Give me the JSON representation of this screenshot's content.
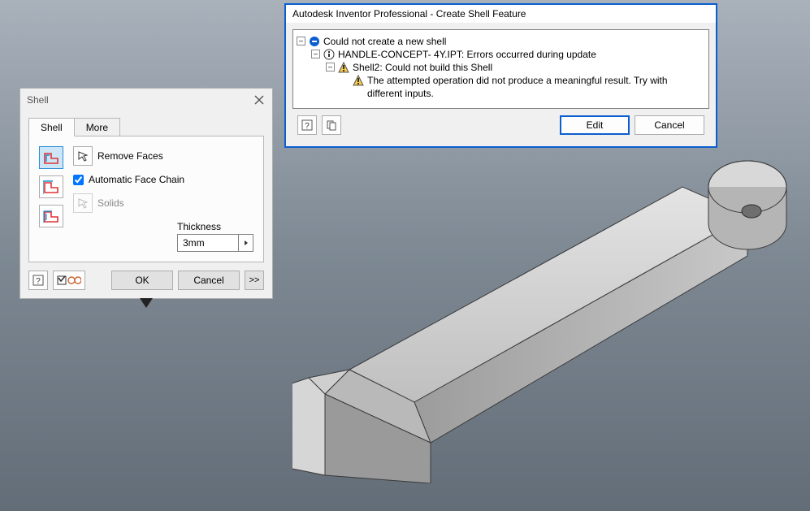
{
  "error_dialog": {
    "title": "Autodesk Inventor Professional - Create Shell Feature",
    "tree": {
      "root": "Could not create a new shell",
      "file": "HANDLE-CONCEPT- 4Y.IPT: Errors occurred during update",
      "feature": "Shell2: Could not build this Shell",
      "detail": "The attempted operation did not produce a meaningful result. Try with different inputs."
    },
    "buttons": {
      "edit": "Edit",
      "cancel": "Cancel"
    }
  },
  "shell_dialog": {
    "title": "Shell",
    "tabs": {
      "shell": "Shell",
      "more": "More"
    },
    "options": {
      "remove_faces": "Remove Faces",
      "auto_face_chain": "Automatic Face Chain",
      "auto_face_chain_checked": true,
      "solids": "Solids"
    },
    "thickness": {
      "label": "Thickness",
      "value": "3mm"
    },
    "buttons": {
      "ok": "OK",
      "cancel": "Cancel",
      "more": ">>"
    }
  }
}
